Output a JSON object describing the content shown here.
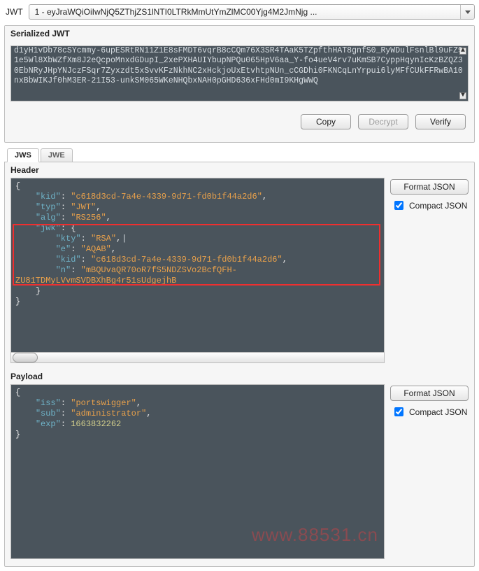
{
  "top": {
    "label": "JWT",
    "dropdown_value": "1 - eyJraWQiOiIwNjQ5ZThjZS1lNTI0LTRkMmUtYmZlMC00Yjg4M2JmNjg ..."
  },
  "serialized": {
    "title": "Serialized JWT",
    "text": "d1yH1vDb78cSYcmmy-6upESRtRN11Z1E8sFMDT6vqrB8cCQm76X3SR4TAaK5TZpfthHAT8gnfS0_RyWDulFsnlBl9uFZ91e5Wl8XbWZfXm8J2eQcpoMnxdGDupI_2xePXHAUIYbupNPQu065HpV6aa_Y-fo4ueV4rv7uKmSB7CyppHqynIcKzBZQZ30EbNRyJHpYNJczFSqr7Zyxzdt5xSvvKFzNkhNC2xHckjoUxEtvhtpNUn_cCGDhi0FKNCqLnYrpui6lyMFfCUkFFRwBA10nxBbWIKJf0hM3ER-21I53-unkSM065WKeNHQbxNAH0pGHD636xFHd0mI9KHgWWQ"
  },
  "buttons": {
    "copy": "Copy",
    "decrypt": "Decrypt",
    "verify": "Verify",
    "format_json": "Format JSON",
    "compact_json": "Compact JSON"
  },
  "tabs": {
    "jws": "JWS",
    "jwe": "JWE"
  },
  "header": {
    "title": "Header",
    "json": {
      "kid": "c618d3cd-7a4e-4339-9d71-fd0b1f44a2d6",
      "typ": "JWT",
      "alg": "RS256",
      "jwk": {
        "kty": "RSA",
        "e": "AQAB",
        "kid": "c618d3cd-7a4e-4339-9d71-fd0b1f44a2d6",
        "n": "mBQUvaQR70oR7fS5NDZSVo2BcfQFH-ZU81TDMyLVvmSVDBXhBg4r51sUdgejhB"
      }
    }
  },
  "payload": {
    "title": "Payload",
    "json": {
      "iss": "portswigger",
      "sub": "administrator",
      "exp": 1663832262
    }
  },
  "watermark": "www.88531.cn"
}
